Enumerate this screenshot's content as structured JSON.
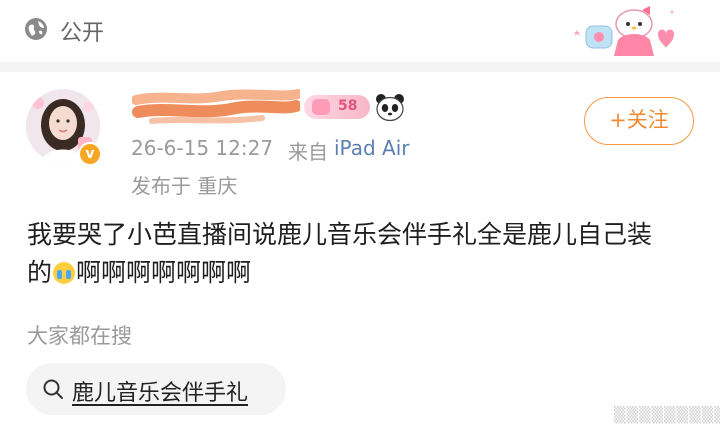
{
  "topbar": {
    "visibility_icon": "globe-icon",
    "visibility_label": "公开",
    "sticker": "hello-kitty-sticker"
  },
  "post": {
    "author": {
      "avatar": "avatar",
      "verified_badge": "v",
      "name_badge_text": "58",
      "name_emoji": "panda-icon"
    },
    "meta": {
      "time": "26-6-15 12:27",
      "source_prefix": "来自",
      "device": "iPad Air",
      "location": "发布于 重庆"
    },
    "follow_label": "+关注",
    "content_line1": "我要哭了小芭直播间说鹿儿音乐会伴手礼全是鹿儿自己装",
    "content_line2_prefix": "的",
    "content_emoji": "crying-emoji",
    "content_line2_suffix": "啊啊啊啊啊啊啊",
    "hot_search_label": "大家都在搜",
    "hot_search_term": "鹿儿音乐会伴手礼"
  },
  "colors": {
    "accent": "#f08a33",
    "link": "#5c7fb2",
    "muted": "#9a9a9a"
  }
}
